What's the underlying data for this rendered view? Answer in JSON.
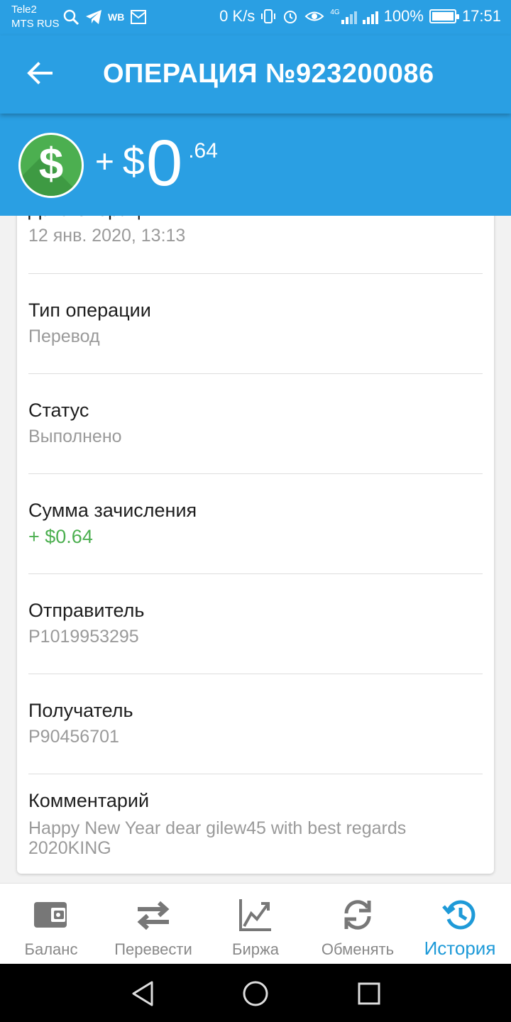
{
  "status_bar": {
    "carrier_line1": "Tele2",
    "carrier_line2": "MTS RUS",
    "wb_label": "WB",
    "network_speed": "0 K/s",
    "network_type": "4G",
    "battery_level": "100%",
    "time": "17:51"
  },
  "header": {
    "title": "ОПЕРАЦИЯ №923200086"
  },
  "amount": {
    "sign": "+",
    "currency": "$",
    "integer": "0",
    "fraction": ".64"
  },
  "details": [
    {
      "label": "Дата операции",
      "value": "12 янв. 2020, 13:13"
    },
    {
      "label": "Тип операции",
      "value": "Перевод"
    },
    {
      "label": "Статус",
      "value": "Выполнено"
    },
    {
      "label": "Сумма зачисления",
      "value": "+ $0.64"
    },
    {
      "label": "Отправитель",
      "value": "P1019953295"
    },
    {
      "label": "Получатель",
      "value": "P90456701"
    },
    {
      "label": "Комментарий",
      "value_line1": "Happy New Year dear gilew45 with best regards",
      "value_line2": "2020KING"
    }
  ],
  "bottom_nav": [
    {
      "label": "Баланс",
      "icon": "wallet-icon",
      "active": false
    },
    {
      "label": "Перевести",
      "icon": "transfer-arrows-icon",
      "active": false
    },
    {
      "label": "Биржа",
      "icon": "chart-icon",
      "active": false
    },
    {
      "label": "Обменять",
      "icon": "exchange-icon",
      "active": false
    },
    {
      "label": "История",
      "icon": "history-icon",
      "active": true
    }
  ],
  "colors": {
    "primary": "#2a9fe3",
    "active_tab": "#1e9ad8",
    "credit_green": "#4caf50",
    "value_gray": "#9a9a9a"
  }
}
